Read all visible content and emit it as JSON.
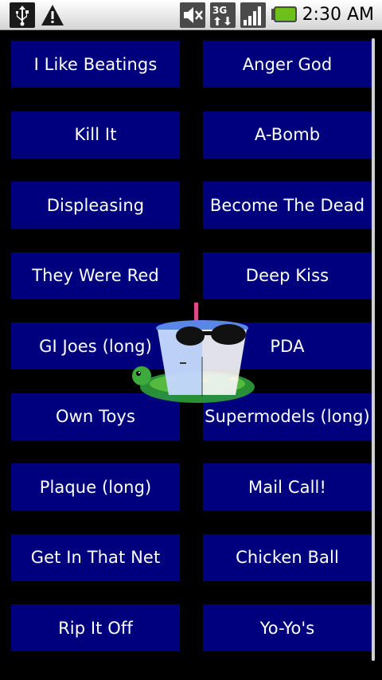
{
  "status_bar": {
    "time": "2:30 AM",
    "icons": [
      "usb-icon",
      "warning-icon",
      "mute-icon",
      "3g-data-icon",
      "signal-icon",
      "battery-icon"
    ]
  },
  "buttons": [
    "I Like Beatings",
    "Anger God",
    "Kill It",
    "A-Bomb",
    "Displeasing",
    "Become The Dead",
    "They Were Red",
    "Deep Kiss",
    "GI Joes (long)",
    "PDA",
    "Own Toys",
    "Supermodels (long)",
    "Plaque (long)",
    "Mail Call!",
    "Get In That Net",
    "Chicken Ball",
    "Rip It Off",
    "Yo-Yo's"
  ],
  "colors": {
    "button_bg": "#00007f",
    "button_text": "#ffffff",
    "background": "#000000",
    "battery": "#6cc01c"
  }
}
